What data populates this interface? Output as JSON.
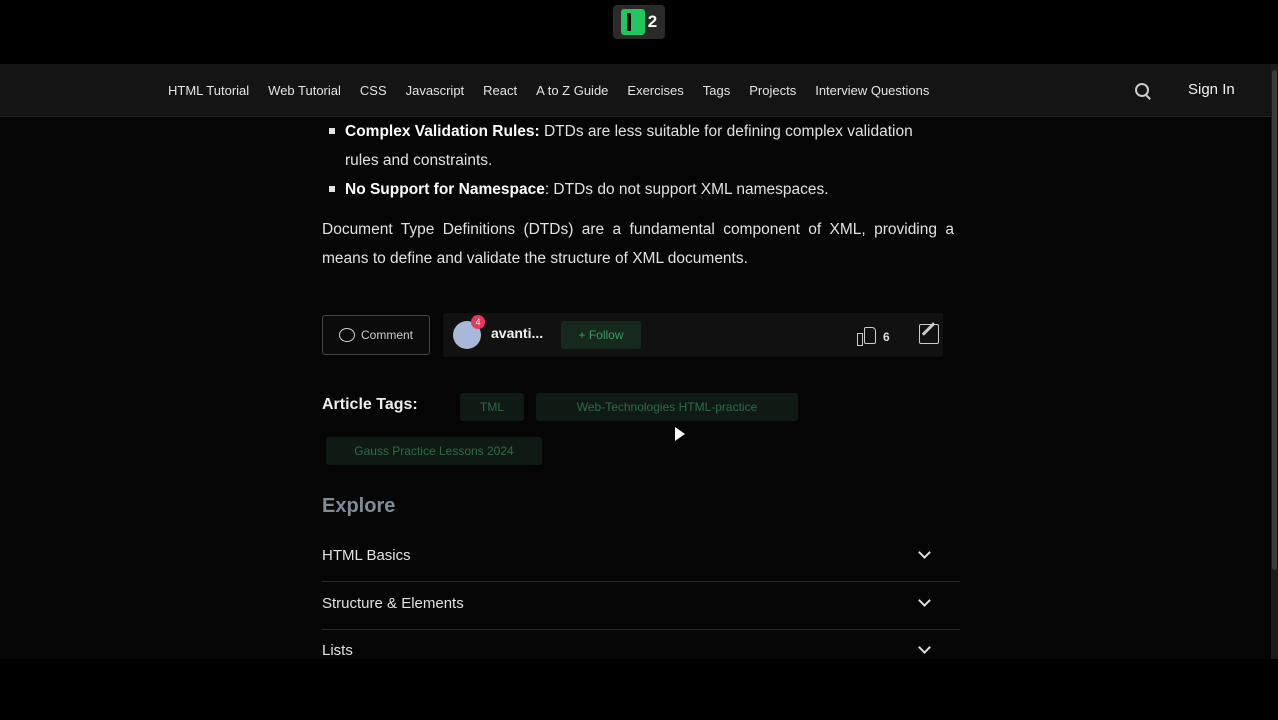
{
  "badge": {
    "number": "2"
  },
  "nav": {
    "links": [
      "HTML Tutorial",
      "Web Tutorial",
      "CSS",
      "Javascript",
      "React",
      "A to Z Guide",
      "Exercises",
      "Tags",
      "Projects",
      "Interview Questions"
    ],
    "sign_in": "Sign In"
  },
  "article": {
    "bullets": [
      {
        "title": "Complex Validation Rules:",
        "text": " DTDs are less suitable for defining complex validation rules and constraints."
      },
      {
        "title": "No Support for Namespace",
        "text": ": DTDs do not support XML namespaces."
      }
    ],
    "summary": "Document Type Definitions (DTDs) are a fundamental component of XML, providing a means to define and validate the structure of XML documents."
  },
  "actions": {
    "comment_label": "Comment",
    "avatar_badge": "4",
    "author_name": "avanti...",
    "follow_label": "+ Follow",
    "like_count": "6"
  },
  "tags": {
    "label": "Article Tags:",
    "items": [
      "TML",
      "Web-Technologies HTML-practice",
      "Gauss Practice Lessons 2024"
    ]
  },
  "explore": {
    "title": "Explore",
    "items": [
      "HTML Basics",
      "Structure & Elements",
      "Lists"
    ]
  }
}
